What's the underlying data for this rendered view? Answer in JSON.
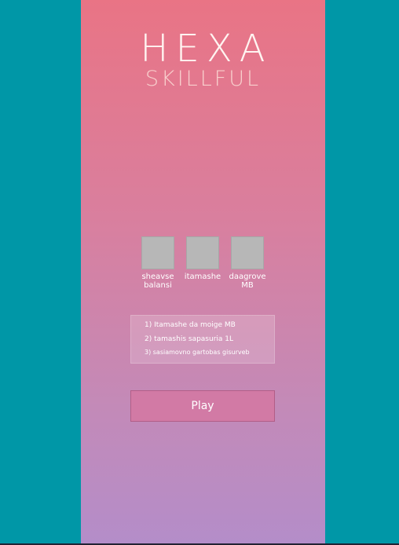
{
  "logo": {
    "title": "HEXA",
    "subtitle": "SKILLFUL"
  },
  "tiles": [
    {
      "label": "sheavse balansi"
    },
    {
      "label": "itamashe"
    },
    {
      "label": "daagrove MB"
    }
  ],
  "rules": [
    "1) Itamashe da moige MB",
    "2) tamashis sapasuria  1L",
    "3) sasiamovno gartobas gisurveb"
  ],
  "play_label": "Play",
  "colors": {
    "background": "#0097a7",
    "gradient_top": "#e97485",
    "gradient_bottom": "#b48dc9",
    "button": "#d27aa5",
    "tile": "#b7b7b7"
  }
}
